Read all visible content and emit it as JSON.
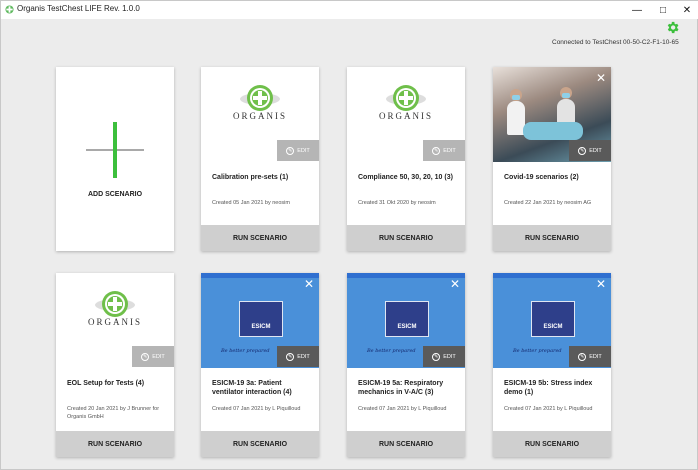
{
  "window": {
    "title": "Organis TestChest LIFE Rev. 1.0.0",
    "connection_status": "Connected to TestChest 00-50-C2-F1-10-65",
    "controls": {
      "minimize": "—",
      "maximize": "□",
      "close": "✕"
    }
  },
  "add_card": {
    "label": "ADD SCENARIO"
  },
  "edit_label": "EDIT",
  "run_label": "RUN SCENARIO",
  "logo_text": "ORGANIS",
  "esicm_text": "ESICM",
  "esicm_tagline": "Be better prepared",
  "scenarios": [
    {
      "title": "Calibration pre-sets (1)",
      "meta": "Created  05 Jan 2021 by neosim"
    },
    {
      "title": "Compliance 50, 30, 20, 10 (3)",
      "meta": "Created  31 Okt 2020 by neosim"
    },
    {
      "title": "Covid-19 scenarios (2)",
      "meta": "Created  22 Jan 2021 by neosim AG"
    },
    {
      "title": "EOL Setup for Tests (4)",
      "meta": "Created  20 Jan 2021 by J Brunner for Organis GmbH"
    },
    {
      "title": "ESICM-19 3a: Patient ventilator interaction (4)",
      "meta": "Created  07 Jan 2021 by L Piquilloud"
    },
    {
      "title": "ESICM-19 5a: Respiratory mechanics in V-A/C (3)",
      "meta": "Created  07 Jan 2021 by L Piquilloud"
    },
    {
      "title": "ESICM-19 5b: Stress index demo (1)",
      "meta": "Created  07 Jan 2021 by L Piquilloud"
    }
  ],
  "colors": {
    "accent_green": "#3cbf3c",
    "esicm_blue": "#4a90d9",
    "top_bar_blue": "#2f6fd0"
  }
}
